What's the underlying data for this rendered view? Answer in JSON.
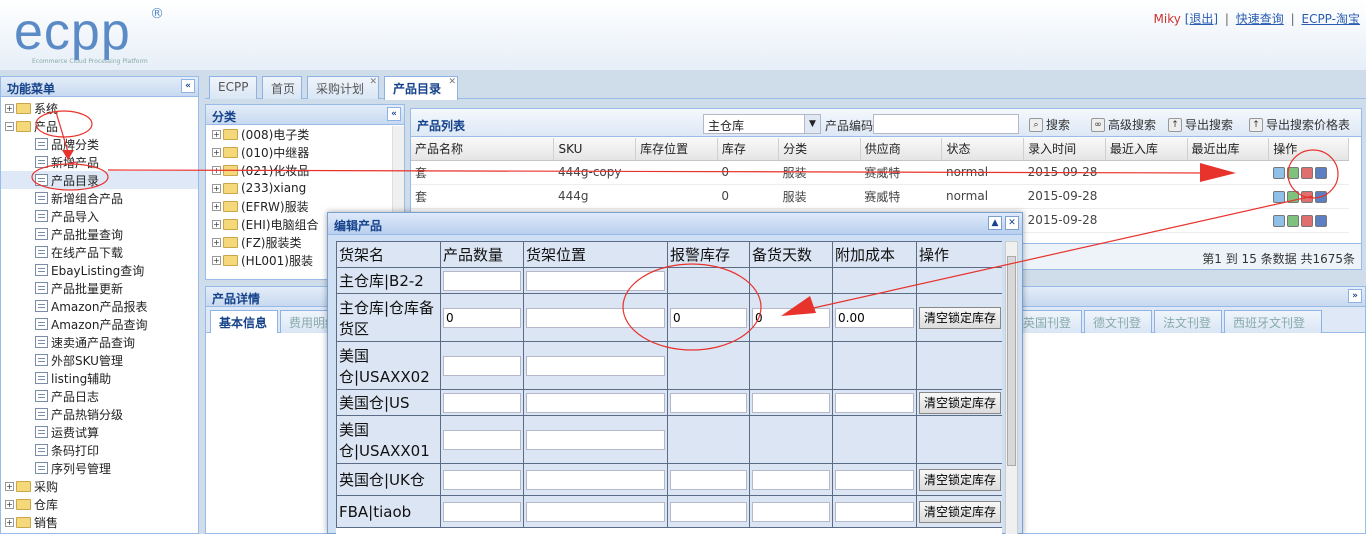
{
  "header": {
    "logo": "ecpp",
    "logo_mark": "®",
    "logo_sub": "Ecommerce Cloud Processing Platform",
    "user": "Miky",
    "logout": "[退出]",
    "quick_search": "快速查询",
    "taobao": "ECPP-淘宝",
    "sep": "|"
  },
  "sidebar": {
    "title": "功能菜单",
    "collapse": "«",
    "groups": [
      {
        "label": "系统",
        "expanded": false
      },
      {
        "label": "产品",
        "expanded": true,
        "items": [
          "品牌分类",
          "新增产品",
          "产品目录",
          "新增组合产品",
          "产品导入",
          "产品批量查询",
          "在线产品下载",
          "EbayListing查询",
          "产品批量更新",
          "Amazon产品报表",
          "Amazon产品查询",
          "速卖通产品查询",
          "外部SKU管理",
          "listing辅助",
          "产品日志",
          "产品热销分级",
          "运费试算",
          "条码打印",
          "序列号管理"
        ]
      },
      {
        "label": "采购",
        "expanded": false
      },
      {
        "label": "仓库",
        "expanded": false
      },
      {
        "label": "销售",
        "expanded": false
      }
    ],
    "selected": "产品目录"
  },
  "tabs": [
    {
      "label": "ECPP",
      "closable": false
    },
    {
      "label": "首页",
      "closable": false
    },
    {
      "label": "采购计划",
      "closable": true
    },
    {
      "label": "产品目录",
      "closable": true,
      "active": true
    }
  ],
  "category": {
    "title": "分类",
    "collapse": "«",
    "items": [
      "(008)电子类",
      "(010)中继器",
      "(021)化妆品",
      "(233)xiang",
      "(EFRW)服装",
      "(EHI)电脑组合",
      "(FZ)服装类",
      "(HL001)服装"
    ]
  },
  "product_list": {
    "title": "产品列表",
    "warehouse": "主仓库",
    "code_label": "产品编码:",
    "code_value": "",
    "buttons": {
      "search": "搜索",
      "advanced": "高级搜索",
      "export": "导出搜索",
      "export_price": "导出搜索价格表"
    },
    "columns": [
      "产品名称",
      "SKU",
      "库存位置",
      "库存",
      "分类",
      "供应商",
      "状态",
      "录入时间",
      "最近入库",
      "最近出库",
      "操作"
    ],
    "rows": [
      {
        "name": "套",
        "sku": "444g-copy",
        "loc": "",
        "stock": "0",
        "cat": "服装",
        "supplier": "赛威特",
        "status": "normal",
        "date": "2015-09-28",
        "in": "",
        "out": ""
      },
      {
        "name": "套",
        "sku": "444g",
        "loc": "",
        "stock": "0",
        "cat": "服装",
        "supplier": "赛威特",
        "status": "normal",
        "date": "2015-09-28",
        "in": "",
        "out": ""
      },
      {
        "name": "",
        "sku": "",
        "loc": "",
        "stock": "",
        "cat": "",
        "supplier": "",
        "status": "",
        "date": "2015-09-28",
        "in": "",
        "out": ""
      }
    ],
    "pageinfo": "第1 到 15 条数据 共1675条"
  },
  "detail": {
    "title": "产品详情",
    "tabs": [
      "基本信息",
      "费用明细",
      "英国刊登",
      "德文刊登",
      "法文刊登",
      "西班牙文刊登"
    ]
  },
  "dialog": {
    "title": "编辑产品",
    "columns": [
      "货架名",
      "产品数量",
      "货架位置",
      "报警库存",
      "备货天数",
      "附加成本",
      "操作"
    ],
    "clear_label": "清空锁定库存",
    "rows": [
      {
        "shelf": "主仓库|B2-2",
        "qty": "",
        "loc": "",
        "alarm": null,
        "days": null,
        "cost": null,
        "clear": false
      },
      {
        "shelf": "主仓库|仓库备货区",
        "qty": "0",
        "loc": "",
        "alarm": "0",
        "days": "0",
        "cost": "0.00",
        "clear": true
      },
      {
        "shelf": "美国仓|USAXX02",
        "qty": "",
        "loc": "",
        "alarm": null,
        "days": null,
        "cost": null,
        "clear": false
      },
      {
        "shelf": "美国仓|US",
        "qty": "",
        "loc": "",
        "alarm": "",
        "days": "",
        "cost": "",
        "clear": true
      },
      {
        "shelf": "美国仓|USAXX01",
        "qty": "",
        "loc": "",
        "alarm": null,
        "days": null,
        "cost": null,
        "clear": false
      },
      {
        "shelf": "英国仓|UK仓",
        "qty": "",
        "loc": "",
        "alarm": "",
        "days": "",
        "cost": "",
        "clear": true
      },
      {
        "shelf": "FBA|tiaob",
        "qty": "",
        "loc": "",
        "alarm": "",
        "days": "",
        "cost": "",
        "clear": true
      }
    ]
  },
  "annotation_color": "#e8322c"
}
